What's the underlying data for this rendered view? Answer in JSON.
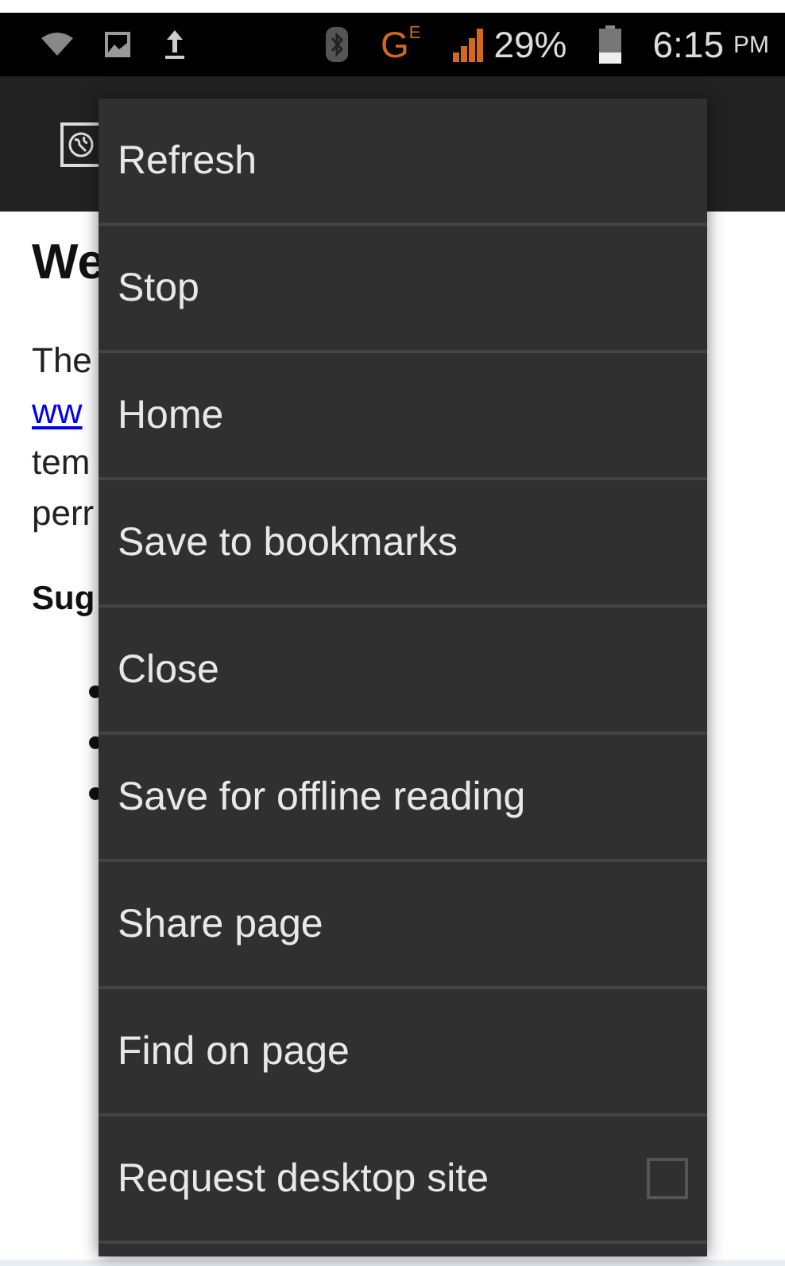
{
  "status_bar": {
    "network_type": "G",
    "network_sub": "E",
    "battery": "29%",
    "time": "6:15",
    "meridiem": "PM"
  },
  "page": {
    "heading": "We",
    "lines": [
      {
        "text": "The",
        "link": false
      },
      {
        "text": "ww",
        "link": true
      },
      {
        "text": "tem",
        "link": false
      },
      {
        "text": "perr",
        "link": false
      }
    ],
    "subheading": "Sug"
  },
  "menu": {
    "items": [
      {
        "label": "Refresh",
        "kind": "plain"
      },
      {
        "label": "Stop",
        "kind": "plain"
      },
      {
        "label": "Home",
        "kind": "plain"
      },
      {
        "label": "Save to bookmarks",
        "kind": "plain"
      },
      {
        "label": "Close",
        "kind": "plain"
      },
      {
        "label": "Save for offline reading",
        "kind": "plain"
      },
      {
        "label": "Share page",
        "kind": "plain"
      },
      {
        "label": "Find on page",
        "kind": "plain"
      },
      {
        "label": "Request desktop site",
        "kind": "checkbox",
        "checked": false
      }
    ]
  }
}
